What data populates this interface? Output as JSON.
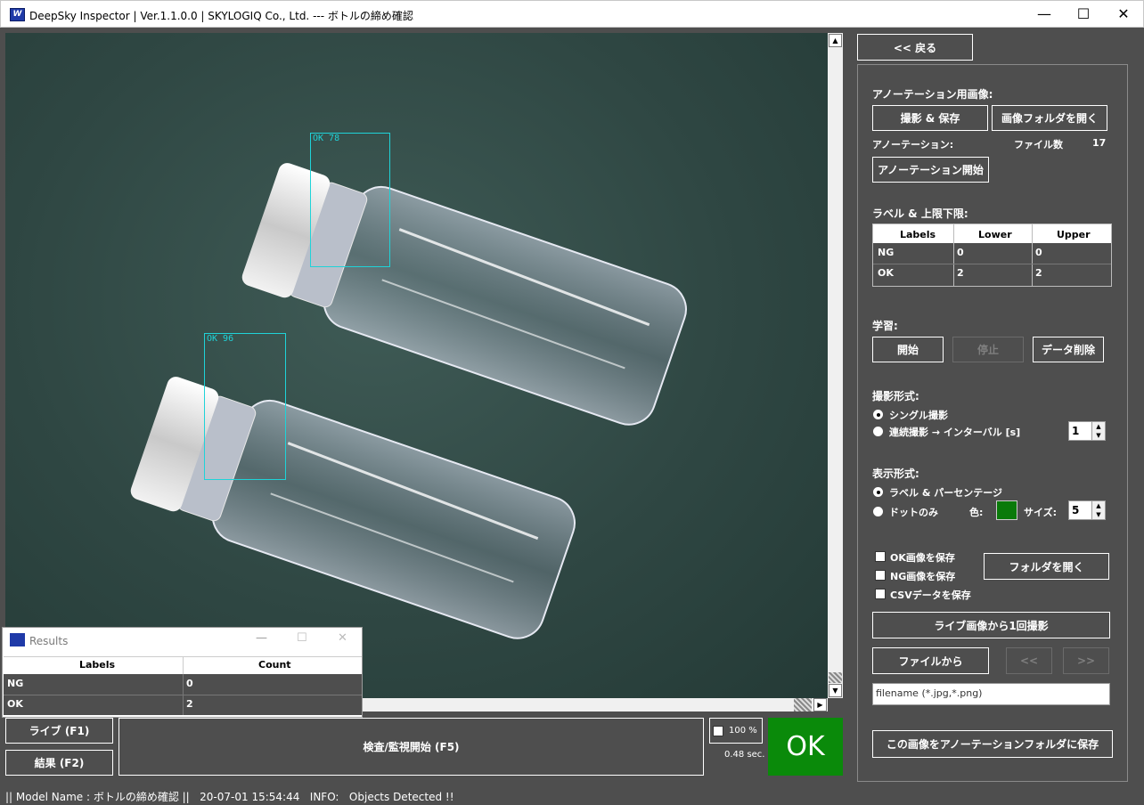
{
  "window": {
    "title": "DeepSky Inspector | Ver.1.1.0.0 | SKYLOGIQ Co., Ltd. --- ボトルの締め確認",
    "minimize": "—",
    "maximize": "☐",
    "close": "✕"
  },
  "viewer": {
    "detections": [
      {
        "label": "OK 78"
      },
      {
        "label": "OK 96"
      }
    ]
  },
  "results_window": {
    "title": "Results",
    "columns": [
      "Labels",
      "Count"
    ],
    "rows": [
      {
        "label": "NG",
        "count": "0"
      },
      {
        "label": "OK",
        "count": "2"
      }
    ]
  },
  "bottom": {
    "live_button": "ライブ (F1)",
    "results_button": "結果 (F2)",
    "start_inspect_button": "検査/監視開始 (F5)",
    "zoom_label": "100 %",
    "time_label": "0.48 sec.",
    "verdict": "OK",
    "verdict_color": "#0a8a0a"
  },
  "panel": {
    "back_button": "<< 戻る",
    "annot_image_heading": "アノーテーション用画像:",
    "capture_save_button": "撮影 & 保存",
    "open_image_folder_button": "画像フォルダを開く",
    "annotation_label": "アノーテーション:",
    "file_count_label": "ファイル数",
    "file_count": "17",
    "start_annotation_button": "アノーテーション開始",
    "label_limits_heading": "ラベル & 上限下限:",
    "limits_columns": [
      "Labels",
      "Lower",
      "Upper"
    ],
    "limits_rows": [
      {
        "label": "NG",
        "lower": "0",
        "upper": "0"
      },
      {
        "label": "OK",
        "lower": "2",
        "upper": "2"
      }
    ],
    "learning_heading": "学習:",
    "learn_start_button": "開始",
    "learn_stop_button": "停止",
    "data_delete_button": "データ削除",
    "capture_mode_heading": "撮影形式:",
    "single_capture": "シングル撮影",
    "continuous_capture": "連続撮影 → インターバル [s]",
    "interval_value": "1",
    "display_mode_heading": "表示形式:",
    "label_percent": "ラベル & パーセンテージ",
    "dots_only": "ドットのみ",
    "color_label": "色:",
    "dot_color": "#0a7a0a",
    "size_label": "サイズ:",
    "size_value": "5",
    "save_ok": "OK画像を保存",
    "save_ng": "NG画像を保存",
    "save_csv": "CSVデータを保存",
    "open_folder_button": "フォルダを開く",
    "capture_from_live_button": "ライブ画像から1回撮影",
    "from_file_button": "ファイルから",
    "prev_button": "<<",
    "next_button": ">>",
    "filename_placeholder": "filename (*.jpg,*.png)",
    "save_to_annot_folder_button": "この画像をアノーテーションフォルダに保存"
  },
  "status": {
    "text": "|| Model Name : ボトルの締め確認 ||   20-07-01 15:54:44   INFO:   Objects Detected !!"
  }
}
